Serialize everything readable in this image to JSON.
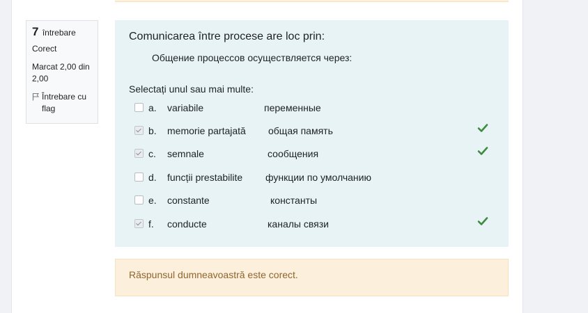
{
  "colors": {
    "accent_correct": "#3d8b3d",
    "formulation_bg": "#e7f3f5",
    "feedback_bg": "#fcefdc",
    "feedback_text": "#8e662e"
  },
  "info": {
    "number": "7",
    "number_label": "întrebare",
    "state": "Corect",
    "grade": "Marcat 2,00 din 2,00",
    "flag_label": "Întrebare cu flag",
    "flag_icon": "flag-outline-icon"
  },
  "question": {
    "text": "Comunicarea între procese are loc prin:",
    "text_ru": "Общение процессов  осуществляется через:",
    "prompt": "Selectați unul sau mai multe:",
    "answers": [
      {
        "letter": "a.",
        "ro": "variabile",
        "ru": "переменные",
        "checked": false,
        "correct_mark": false
      },
      {
        "letter": "b.",
        "ro": "memorie partajată",
        "ru": "общая память",
        "checked": true,
        "correct_mark": true
      },
      {
        "letter": "c.",
        "ro": "semnale",
        "ru": "сообщения",
        "checked": true,
        "correct_mark": true
      },
      {
        "letter": "d.",
        "ro": "funcții prestabilite",
        "ru": "функции по умолчанию",
        "checked": false,
        "correct_mark": false
      },
      {
        "letter": "e.",
        "ro": "constante",
        "ru": "константы",
        "checked": false,
        "correct_mark": false
      },
      {
        "letter": "f.",
        "ro": "conducte",
        "ru": "каналы связи",
        "checked": true,
        "correct_mark": true
      }
    ]
  },
  "feedback": {
    "text": "Răspunsul dumneavoastră este corect."
  }
}
